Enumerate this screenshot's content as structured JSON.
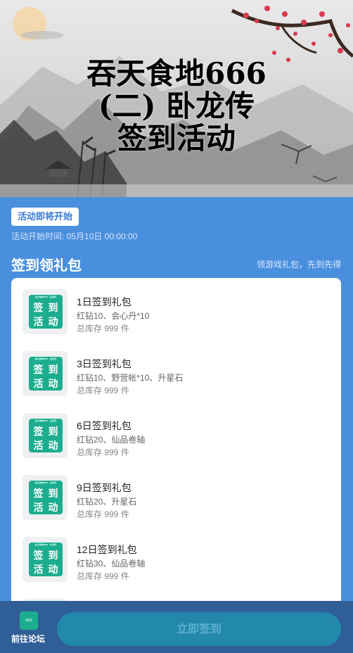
{
  "banner": {
    "title_lines": [
      "吞天食地666",
      "(二) 卧龙传",
      "签到活动"
    ]
  },
  "status": {
    "badge": "活动即将开始",
    "start_time": "活动开始时间: 05月10日 00:00:00"
  },
  "section": {
    "title": "签到领礼包",
    "hint": "领游戏礼包，先到先得"
  },
  "gift_icon": {
    "row1": [
      "签",
      "到"
    ],
    "row2": [
      "活",
      "动"
    ],
    "tiny_text": "吞天食地666 · 卧龙传"
  },
  "gifts": [
    {
      "name": "1日签到礼包",
      "content": "红钻10、会心丹*10",
      "stock": "总库存 999 件"
    },
    {
      "name": "3日签到礼包",
      "content": "红钻10、野营帐*10、升星石",
      "stock": "总库存 999 件"
    },
    {
      "name": "6日签到礼包",
      "content": "红钻20、仙品卷轴",
      "stock": "总库存 999 件"
    },
    {
      "name": "9日签到礼包",
      "content": "红钻20、升星石",
      "stock": "总库存 999 件"
    },
    {
      "name": "12日签到礼包",
      "content": "红钻30、仙品卷轴",
      "stock": "总库存 999 件"
    }
  ],
  "bottom": {
    "forum_label": "前往论坛",
    "forum_icon_text": "666",
    "checkin_label": "立即签到"
  },
  "colors": {
    "background": "#4a8fdd",
    "accent_green": "#1cad8e",
    "bottom_bar": "#2f5f96",
    "button": "#2288ac"
  }
}
